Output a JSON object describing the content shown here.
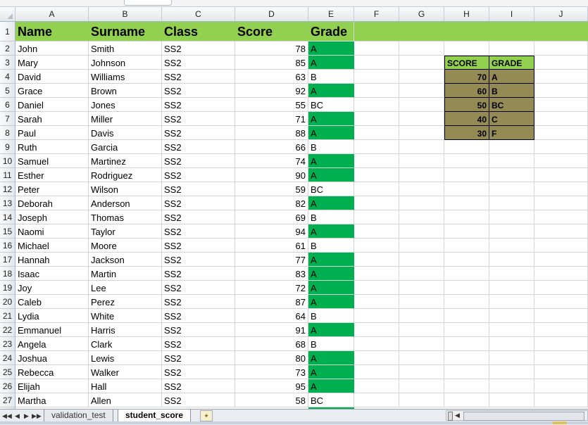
{
  "formula_bar": {
    "name_box": "",
    "formula": ""
  },
  "columns": [
    "A",
    "B",
    "C",
    "D",
    "E",
    "F",
    "G",
    "H",
    "I",
    "J"
  ],
  "header_row": {
    "row": "1",
    "name": "Name",
    "surname": "Surname",
    "class": "Class",
    "score": "Score",
    "grade": "Grade"
  },
  "students": [
    {
      "row": "2",
      "name": "John",
      "surname": "Smith",
      "class": "SS2",
      "score": "78",
      "grade": "A"
    },
    {
      "row": "3",
      "name": "Mary",
      "surname": "Johnson",
      "class": "SS2",
      "score": "85",
      "grade": "A"
    },
    {
      "row": "4",
      "name": "David",
      "surname": "Williams",
      "class": "SS2",
      "score": "63",
      "grade": "B"
    },
    {
      "row": "5",
      "name": "Grace",
      "surname": "Brown",
      "class": "SS2",
      "score": "92",
      "grade": "A"
    },
    {
      "row": "6",
      "name": "Daniel",
      "surname": "Jones",
      "class": "SS2",
      "score": "55",
      "grade": "BC"
    },
    {
      "row": "7",
      "name": "Sarah",
      "surname": "Miller",
      "class": "SS2",
      "score": "71",
      "grade": "A"
    },
    {
      "row": "8",
      "name": "Paul",
      "surname": "Davis",
      "class": "SS2",
      "score": "88",
      "grade": "A"
    },
    {
      "row": "9",
      "name": "Ruth",
      "surname": "Garcia",
      "class": "SS2",
      "score": "66",
      "grade": "B"
    },
    {
      "row": "10",
      "name": "Samuel",
      "surname": "Martinez",
      "class": "SS2",
      "score": "74",
      "grade": "A"
    },
    {
      "row": "11",
      "name": "Esther",
      "surname": "Rodriguez",
      "class": "SS2",
      "score": "90",
      "grade": "A"
    },
    {
      "row": "12",
      "name": "Peter",
      "surname": "Wilson",
      "class": "SS2",
      "score": "59",
      "grade": "BC"
    },
    {
      "row": "13",
      "name": "Deborah",
      "surname": "Anderson",
      "class": "SS2",
      "score": "82",
      "grade": "A"
    },
    {
      "row": "14",
      "name": "Joseph",
      "surname": "Thomas",
      "class": "SS2",
      "score": "69",
      "grade": "B"
    },
    {
      "row": "15",
      "name": "Naomi",
      "surname": "Taylor",
      "class": "SS2",
      "score": "94",
      "grade": "A"
    },
    {
      "row": "16",
      "name": "Michael",
      "surname": "Moore",
      "class": "SS2",
      "score": "61",
      "grade": "B"
    },
    {
      "row": "17",
      "name": "Hannah",
      "surname": "Jackson",
      "class": "SS2",
      "score": "77",
      "grade": "A"
    },
    {
      "row": "18",
      "name": "Isaac",
      "surname": "Martin",
      "class": "SS2",
      "score": "83",
      "grade": "A"
    },
    {
      "row": "19",
      "name": "Joy",
      "surname": "Lee",
      "class": "SS2",
      "score": "72",
      "grade": "A"
    },
    {
      "row": "20",
      "name": "Caleb",
      "surname": "Perez",
      "class": "SS2",
      "score": "87",
      "grade": "A"
    },
    {
      "row": "21",
      "name": "Lydia",
      "surname": "White",
      "class": "SS2",
      "score": "64",
      "grade": "B"
    },
    {
      "row": "22",
      "name": "Emmanuel",
      "surname": "Harris",
      "class": "SS2",
      "score": "91",
      "grade": "A"
    },
    {
      "row": "23",
      "name": "Angela",
      "surname": "Clark",
      "class": "SS2",
      "score": "68",
      "grade": "B"
    },
    {
      "row": "24",
      "name": "Joshua",
      "surname": "Lewis",
      "class": "SS2",
      "score": "80",
      "grade": "A"
    },
    {
      "row": "25",
      "name": "Rebecca",
      "surname": "Walker",
      "class": "SS2",
      "score": "73",
      "grade": "A"
    },
    {
      "row": "26",
      "name": "Elijah",
      "surname": "Hall",
      "class": "SS2",
      "score": "95",
      "grade": "A"
    },
    {
      "row": "27",
      "name": "Martha",
      "surname": "Allen",
      "class": "SS2",
      "score": "58",
      "grade": "BC"
    }
  ],
  "lookup_table": {
    "score_header": "SCORE",
    "grade_header": "GRADE",
    "rows": [
      {
        "score": "70",
        "grade": "A"
      },
      {
        "score": "60",
        "grade": "B"
      },
      {
        "score": "50",
        "grade": "BC"
      },
      {
        "score": "40",
        "grade": "C"
      },
      {
        "score": "30",
        "grade": "F"
      }
    ]
  },
  "sheet_tabs": [
    {
      "label": "validation_test",
      "active": false
    },
    {
      "label": "student_score",
      "active": true
    }
  ],
  "colors": {
    "header_green": "#92d050",
    "grade_a_fill": "#00b050",
    "lookup_fill": "#948a54"
  }
}
